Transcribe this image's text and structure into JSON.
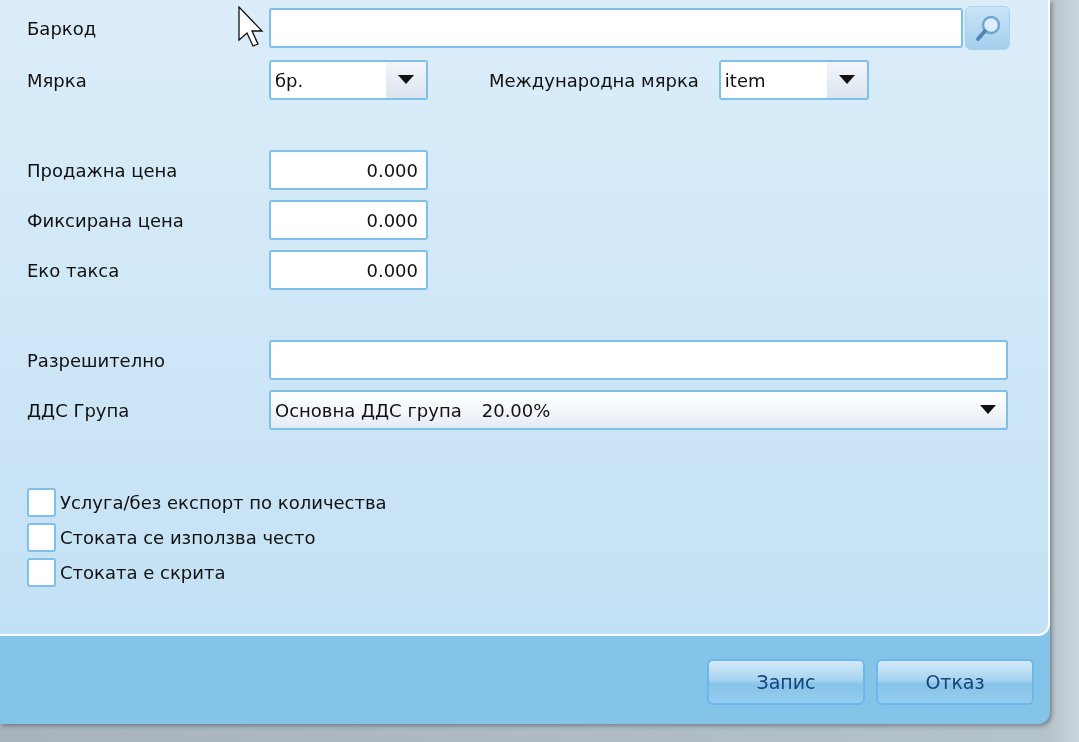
{
  "form": {
    "barcode": {
      "label": "Баркод"
    },
    "unit": {
      "label": "Мярка",
      "value": "бр."
    },
    "intl_unit": {
      "label": "Международна мярка",
      "value": "item"
    },
    "prices": [
      {
        "label": "Продажна цена",
        "value": "0.000"
      },
      {
        "label": "Фиксирана цена",
        "value": "0.000"
      },
      {
        "label": "Еко такса",
        "value": "0.000"
      }
    ],
    "permit": {
      "label": "Разрешително"
    },
    "vat_group": {
      "label": "ДДС Група",
      "value": "Основна ДДС група",
      "rate": "20.00%"
    }
  },
  "checkboxes": [
    {
      "label": "Услуга/без експорт по количества",
      "checked": false
    },
    {
      "label": "Стоката се използва често",
      "checked": false
    },
    {
      "label": "Стоката е скрита",
      "checked": false
    }
  ],
  "buttons": [
    "Запис",
    "Отказ"
  ]
}
